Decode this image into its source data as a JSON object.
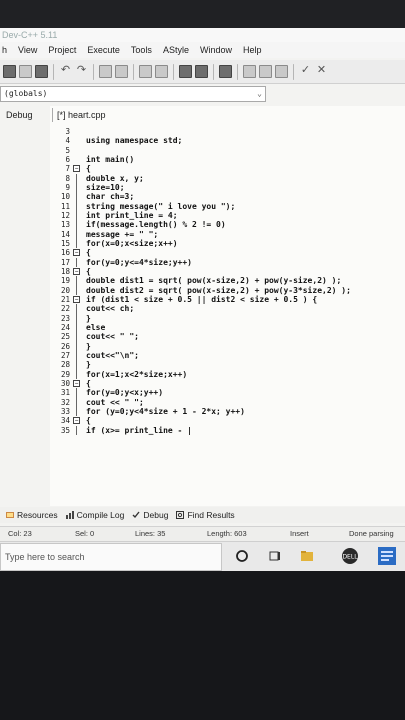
{
  "window": {
    "title": "Dev-C++ 5.11"
  },
  "menu": [
    "h",
    "View",
    "Project",
    "Execute",
    "Tools",
    "AStyle",
    "Window",
    "Help"
  ],
  "scope": {
    "value": "(globals)"
  },
  "left_panel": {
    "tab": "Debug"
  },
  "editor": {
    "file_tab": "[*] heart.cpp",
    "lines": [
      {
        "n": "3",
        "code": ""
      },
      {
        "n": "4",
        "code": "using namespace std;"
      },
      {
        "n": "5",
        "code": ""
      },
      {
        "n": "6",
        "code": "int main()"
      },
      {
        "n": "7",
        "code": "{",
        "fold": true
      },
      {
        "n": "8",
        "code": "double x, y;"
      },
      {
        "n": "9",
        "code": "size=10;"
      },
      {
        "n": "10",
        "code": "char ch=3;"
      },
      {
        "n": "11",
        "code": "string message(\" i love you \");"
      },
      {
        "n": "12",
        "code": "int print_line = 4;"
      },
      {
        "n": "13",
        "code": "if(message.length() % 2 != 0)"
      },
      {
        "n": "14",
        "code": "message += \" \";"
      },
      {
        "n": "15",
        "code": "for(x=0;x<size;x++)"
      },
      {
        "n": "16",
        "code": "{",
        "fold": true
      },
      {
        "n": "17",
        "code": "for(y=0;y<=4*size;y++)"
      },
      {
        "n": "18",
        "code": "{",
        "fold": true
      },
      {
        "n": "19",
        "code": "double dist1 = sqrt( pow(x-size,2) + pow(y-size,2) );"
      },
      {
        "n": "20",
        "code": "double dist2 = sqrt( pow(x-size,2) + pow(y-3*size,2) );"
      },
      {
        "n": "21",
        "code": "if (dist1 < size + 0.5 || dist2 < size + 0.5 ) {",
        "fold": true
      },
      {
        "n": "22",
        "code": "cout<< ch;"
      },
      {
        "n": "23",
        "code": "}"
      },
      {
        "n": "24",
        "code": "else"
      },
      {
        "n": "25",
        "code": "cout<< \" \";"
      },
      {
        "n": "26",
        "code": "}"
      },
      {
        "n": "27",
        "code": "cout<<\"\\n\";"
      },
      {
        "n": "28",
        "code": "}"
      },
      {
        "n": "29",
        "code": "for(x=1;x<2*size;x++)"
      },
      {
        "n": "30",
        "code": "{",
        "fold": true
      },
      {
        "n": "31",
        "code": "for(y=0;y<x;y++)"
      },
      {
        "n": "32",
        "code": "cout << \" \";"
      },
      {
        "n": "33",
        "code": "for (y=0;y<4*size + 1 - 2*x; y++)"
      },
      {
        "n": "34",
        "code": "{",
        "fold": true
      },
      {
        "n": "35",
        "code": "if (x>= print_line - |"
      }
    ]
  },
  "bottom_tabs": {
    "resources": "Resources",
    "compile_log": "Compile Log",
    "debug": "Debug",
    "find_results": "Find Results"
  },
  "status": {
    "col": "Col:  23",
    "sel": "Sel:  0",
    "lines": "Lines:  35",
    "length": "Length:  603",
    "mode": "Insert",
    "state": "Done parsing"
  },
  "taskbar": {
    "search_placeholder": "Type here to search"
  },
  "colors": {
    "editor_bg": "#fbfbf9",
    "taskbar_bg": "#e9e9e9",
    "accent": "#2b6cc4"
  }
}
